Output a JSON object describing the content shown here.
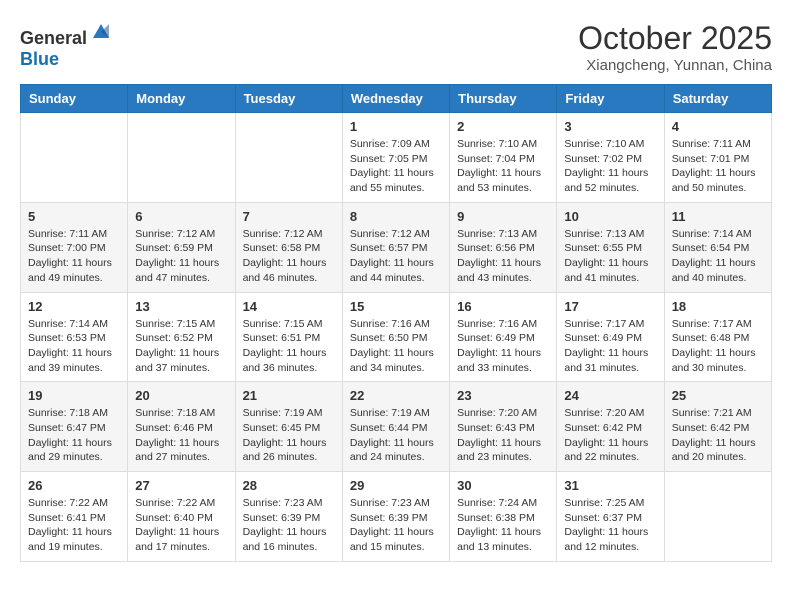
{
  "logo": {
    "general": "General",
    "blue": "Blue"
  },
  "header": {
    "month": "October 2025",
    "location": "Xiangcheng, Yunnan, China"
  },
  "weekdays": [
    "Sunday",
    "Monday",
    "Tuesday",
    "Wednesday",
    "Thursday",
    "Friday",
    "Saturday"
  ],
  "weeks": [
    [
      {
        "day": "",
        "sunrise": "",
        "sunset": "",
        "daylight": ""
      },
      {
        "day": "",
        "sunrise": "",
        "sunset": "",
        "daylight": ""
      },
      {
        "day": "",
        "sunrise": "",
        "sunset": "",
        "daylight": ""
      },
      {
        "day": "1",
        "sunrise": "Sunrise: 7:09 AM",
        "sunset": "Sunset: 7:05 PM",
        "daylight": "Daylight: 11 hours and 55 minutes."
      },
      {
        "day": "2",
        "sunrise": "Sunrise: 7:10 AM",
        "sunset": "Sunset: 7:04 PM",
        "daylight": "Daylight: 11 hours and 53 minutes."
      },
      {
        "day": "3",
        "sunrise": "Sunrise: 7:10 AM",
        "sunset": "Sunset: 7:02 PM",
        "daylight": "Daylight: 11 hours and 52 minutes."
      },
      {
        "day": "4",
        "sunrise": "Sunrise: 7:11 AM",
        "sunset": "Sunset: 7:01 PM",
        "daylight": "Daylight: 11 hours and 50 minutes."
      }
    ],
    [
      {
        "day": "5",
        "sunrise": "Sunrise: 7:11 AM",
        "sunset": "Sunset: 7:00 PM",
        "daylight": "Daylight: 11 hours and 49 minutes."
      },
      {
        "day": "6",
        "sunrise": "Sunrise: 7:12 AM",
        "sunset": "Sunset: 6:59 PM",
        "daylight": "Daylight: 11 hours and 47 minutes."
      },
      {
        "day": "7",
        "sunrise": "Sunrise: 7:12 AM",
        "sunset": "Sunset: 6:58 PM",
        "daylight": "Daylight: 11 hours and 46 minutes."
      },
      {
        "day": "8",
        "sunrise": "Sunrise: 7:12 AM",
        "sunset": "Sunset: 6:57 PM",
        "daylight": "Daylight: 11 hours and 44 minutes."
      },
      {
        "day": "9",
        "sunrise": "Sunrise: 7:13 AM",
        "sunset": "Sunset: 6:56 PM",
        "daylight": "Daylight: 11 hours and 43 minutes."
      },
      {
        "day": "10",
        "sunrise": "Sunrise: 7:13 AM",
        "sunset": "Sunset: 6:55 PM",
        "daylight": "Daylight: 11 hours and 41 minutes."
      },
      {
        "day": "11",
        "sunrise": "Sunrise: 7:14 AM",
        "sunset": "Sunset: 6:54 PM",
        "daylight": "Daylight: 11 hours and 40 minutes."
      }
    ],
    [
      {
        "day": "12",
        "sunrise": "Sunrise: 7:14 AM",
        "sunset": "Sunset: 6:53 PM",
        "daylight": "Daylight: 11 hours and 39 minutes."
      },
      {
        "day": "13",
        "sunrise": "Sunrise: 7:15 AM",
        "sunset": "Sunset: 6:52 PM",
        "daylight": "Daylight: 11 hours and 37 minutes."
      },
      {
        "day": "14",
        "sunrise": "Sunrise: 7:15 AM",
        "sunset": "Sunset: 6:51 PM",
        "daylight": "Daylight: 11 hours and 36 minutes."
      },
      {
        "day": "15",
        "sunrise": "Sunrise: 7:16 AM",
        "sunset": "Sunset: 6:50 PM",
        "daylight": "Daylight: 11 hours and 34 minutes."
      },
      {
        "day": "16",
        "sunrise": "Sunrise: 7:16 AM",
        "sunset": "Sunset: 6:49 PM",
        "daylight": "Daylight: 11 hours and 33 minutes."
      },
      {
        "day": "17",
        "sunrise": "Sunrise: 7:17 AM",
        "sunset": "Sunset: 6:49 PM",
        "daylight": "Daylight: 11 hours and 31 minutes."
      },
      {
        "day": "18",
        "sunrise": "Sunrise: 7:17 AM",
        "sunset": "Sunset: 6:48 PM",
        "daylight": "Daylight: 11 hours and 30 minutes."
      }
    ],
    [
      {
        "day": "19",
        "sunrise": "Sunrise: 7:18 AM",
        "sunset": "Sunset: 6:47 PM",
        "daylight": "Daylight: 11 hours and 29 minutes."
      },
      {
        "day": "20",
        "sunrise": "Sunrise: 7:18 AM",
        "sunset": "Sunset: 6:46 PM",
        "daylight": "Daylight: 11 hours and 27 minutes."
      },
      {
        "day": "21",
        "sunrise": "Sunrise: 7:19 AM",
        "sunset": "Sunset: 6:45 PM",
        "daylight": "Daylight: 11 hours and 26 minutes."
      },
      {
        "day": "22",
        "sunrise": "Sunrise: 7:19 AM",
        "sunset": "Sunset: 6:44 PM",
        "daylight": "Daylight: 11 hours and 24 minutes."
      },
      {
        "day": "23",
        "sunrise": "Sunrise: 7:20 AM",
        "sunset": "Sunset: 6:43 PM",
        "daylight": "Daylight: 11 hours and 23 minutes."
      },
      {
        "day": "24",
        "sunrise": "Sunrise: 7:20 AM",
        "sunset": "Sunset: 6:42 PM",
        "daylight": "Daylight: 11 hours and 22 minutes."
      },
      {
        "day": "25",
        "sunrise": "Sunrise: 7:21 AM",
        "sunset": "Sunset: 6:42 PM",
        "daylight": "Daylight: 11 hours and 20 minutes."
      }
    ],
    [
      {
        "day": "26",
        "sunrise": "Sunrise: 7:22 AM",
        "sunset": "Sunset: 6:41 PM",
        "daylight": "Daylight: 11 hours and 19 minutes."
      },
      {
        "day": "27",
        "sunrise": "Sunrise: 7:22 AM",
        "sunset": "Sunset: 6:40 PM",
        "daylight": "Daylight: 11 hours and 17 minutes."
      },
      {
        "day": "28",
        "sunrise": "Sunrise: 7:23 AM",
        "sunset": "Sunset: 6:39 PM",
        "daylight": "Daylight: 11 hours and 16 minutes."
      },
      {
        "day": "29",
        "sunrise": "Sunrise: 7:23 AM",
        "sunset": "Sunset: 6:39 PM",
        "daylight": "Daylight: 11 hours and 15 minutes."
      },
      {
        "day": "30",
        "sunrise": "Sunrise: 7:24 AM",
        "sunset": "Sunset: 6:38 PM",
        "daylight": "Daylight: 11 hours and 13 minutes."
      },
      {
        "day": "31",
        "sunrise": "Sunrise: 7:25 AM",
        "sunset": "Sunset: 6:37 PM",
        "daylight": "Daylight: 11 hours and 12 minutes."
      },
      {
        "day": "",
        "sunrise": "",
        "sunset": "",
        "daylight": ""
      }
    ]
  ]
}
